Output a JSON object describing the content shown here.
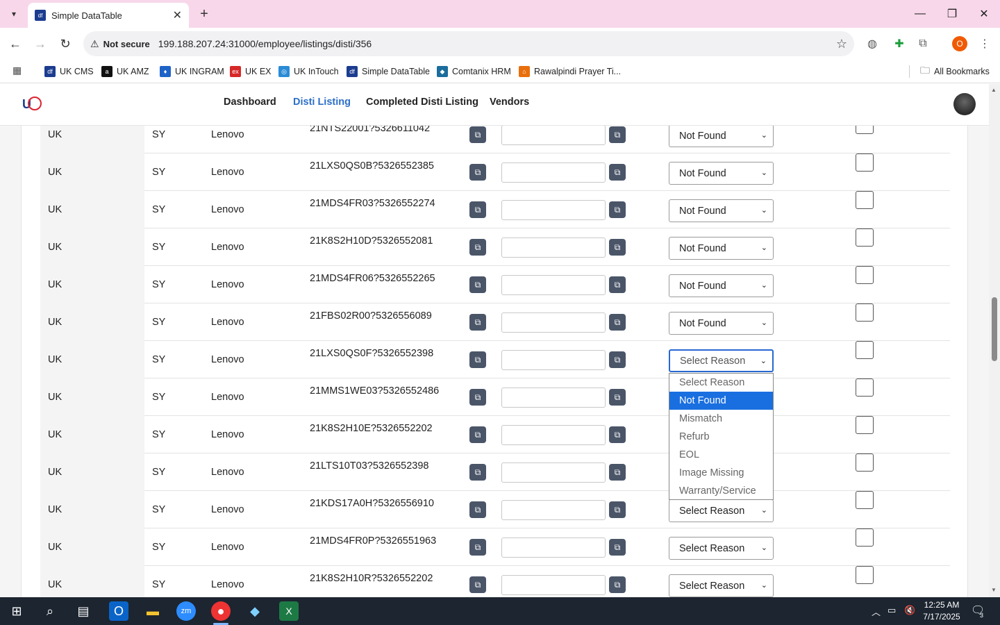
{
  "browser": {
    "tab_title": "Simple DataTable",
    "tab_close": "✕",
    "new_tab": "+",
    "not_secure": "Not secure",
    "url": "199.188.207.24:31000/employee/listings/disti/356",
    "profile_initial": "O"
  },
  "bookmarks": [
    {
      "label": "UK CMS",
      "color": "#1b3c8f",
      "glyph": "df"
    },
    {
      "label": "UK AMZ",
      "color": "#111111",
      "glyph": "a"
    },
    {
      "label": "UK INGRAM",
      "color": "#1e63c7",
      "glyph": "♦"
    },
    {
      "label": "UK EX",
      "color": "#d62828",
      "glyph": "ex"
    },
    {
      "label": "UK InTouch",
      "color": "#2a8bd6",
      "glyph": "◎"
    },
    {
      "label": "Simple DataTable",
      "color": "#1b3c8f",
      "glyph": "df"
    },
    {
      "label": "Comtanix HRM",
      "color": "#1a6d9c",
      "glyph": "◆"
    },
    {
      "label": "Rawalpindi Prayer Ti...",
      "color": "#e86f0c",
      "glyph": "⌂"
    }
  ],
  "all_bookmarks": "All Bookmarks",
  "nav": {
    "dashboard": "Dashboard",
    "disti_listing": "Disti Listing",
    "completed": "Completed Disti Listing",
    "vendors": "Vendors"
  },
  "rows": [
    {
      "region": "UK",
      "code": "SY",
      "brand": "Lenovo",
      "sku": "21NTS22001?5326611042",
      "reason": "Not Found"
    },
    {
      "region": "UK",
      "code": "SY",
      "brand": "Lenovo",
      "sku": "21LXS0QS0B?5326552385",
      "reason": "Not Found"
    },
    {
      "region": "UK",
      "code": "SY",
      "brand": "Lenovo",
      "sku": "21MDS4FR03?5326552274",
      "reason": "Not Found"
    },
    {
      "region": "UK",
      "code": "SY",
      "brand": "Lenovo",
      "sku": "21K8S2H10D?5326552081",
      "reason": "Not Found"
    },
    {
      "region": "UK",
      "code": "SY",
      "brand": "Lenovo",
      "sku": "21MDS4FR06?5326552265",
      "reason": "Not Found"
    },
    {
      "region": "UK",
      "code": "SY",
      "brand": "Lenovo",
      "sku": "21FBS02R00?5326556089",
      "reason": "Not Found"
    },
    {
      "region": "UK",
      "code": "SY",
      "brand": "Lenovo",
      "sku": "21LXS0QS0F?5326552398",
      "reason": "Select Reason"
    },
    {
      "region": "UK",
      "code": "SY",
      "brand": "Lenovo",
      "sku": "21MMS1WE03?5326552486",
      "reason": ""
    },
    {
      "region": "UK",
      "code": "SY",
      "brand": "Lenovo",
      "sku": "21K8S2H10E?5326552202",
      "reason": ""
    },
    {
      "region": "UK",
      "code": "SY",
      "brand": "Lenovo",
      "sku": "21LTS10T03?5326552398",
      "reason": ""
    },
    {
      "region": "UK",
      "code": "SY",
      "brand": "Lenovo",
      "sku": "21KDS17A0H?5326556910",
      "reason": "Select Reason"
    },
    {
      "region": "UK",
      "code": "SY",
      "brand": "Lenovo",
      "sku": "21MDS4FR0P?5326551963",
      "reason": "Select Reason"
    },
    {
      "region": "UK",
      "code": "SY",
      "brand": "Lenovo",
      "sku": "21K8S2H10R?5326552202",
      "reason": "Select Reason"
    }
  ],
  "dropdown": {
    "options": [
      "Select Reason",
      "Not Found",
      "Mismatch",
      "Refurb",
      "EOL",
      "Image Missing",
      "Warranty/Service"
    ],
    "highlighted": "Not Found"
  },
  "taskbar": {
    "time": "12:25 AM",
    "date": "7/17/2025",
    "notifications": "3"
  },
  "colors": {
    "titlebar": "#f8d7ea",
    "accent": "#2d6fc9",
    "highlight": "#1a6fe0"
  }
}
